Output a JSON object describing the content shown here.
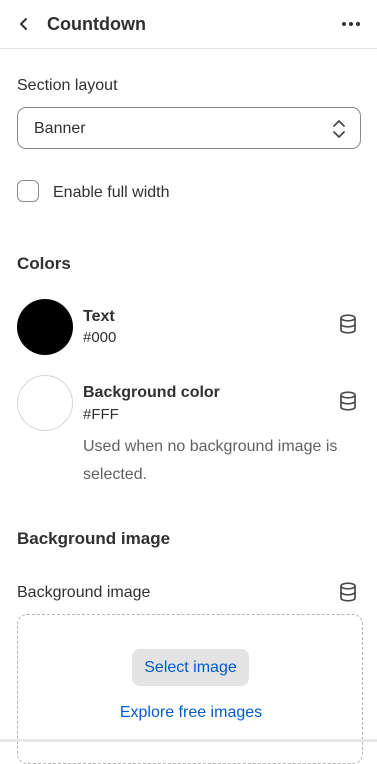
{
  "header": {
    "title": "Countdown",
    "back_icon": "chevron-left-icon",
    "more_icon": "ellipsis-horizontal-icon"
  },
  "layout": {
    "label": "Section layout",
    "select_value": "Banner",
    "select_icon": "select-chevron-icon"
  },
  "full_width": {
    "label": "Enable full width",
    "checked": false
  },
  "colors": {
    "heading": "Colors",
    "items": [
      {
        "name": "Text",
        "value": "#000",
        "swatch": "#000000",
        "icon": "database-icon"
      },
      {
        "name": "Background color",
        "value": "#FFF",
        "swatch": "#FFFFFF",
        "icon": "database-icon",
        "help": "Used when no background image is selected."
      }
    ]
  },
  "background": {
    "heading": "Background image",
    "field_label": "Background image",
    "field_icon": "database-icon",
    "select_button": "Select image",
    "explore_link": "Explore free images"
  },
  "theme": {
    "text": "#303030",
    "muted": "#616161",
    "link": "#005bd3",
    "border": "#8a8a8a"
  }
}
